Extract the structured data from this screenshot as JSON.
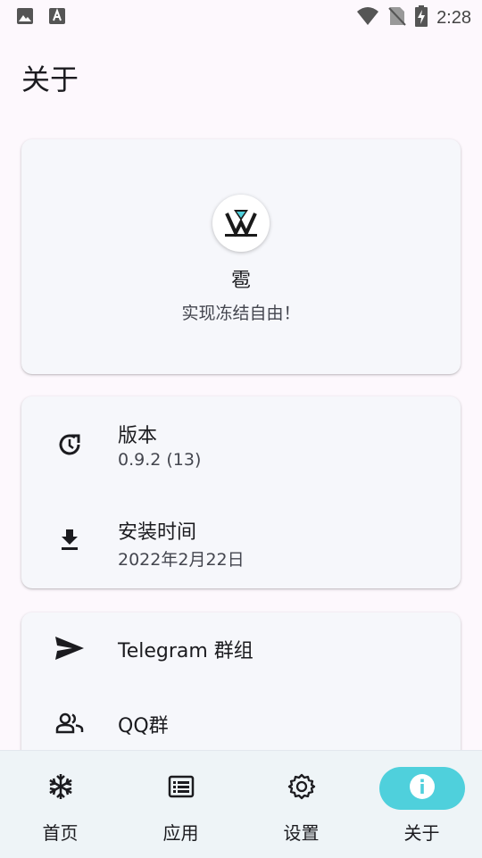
{
  "status_bar": {
    "time": "2:28"
  },
  "page": {
    "title": "关于"
  },
  "app": {
    "name": "雹",
    "tagline": "实现冻结自由！"
  },
  "info": {
    "version": {
      "label": "版本",
      "value": "0.9.2 (13)"
    },
    "install": {
      "label": "安装时间",
      "value": "2022年2月22日"
    }
  },
  "links": {
    "telegram": {
      "label": "Telegram 群组"
    },
    "qq": {
      "label": "QQ群"
    }
  },
  "nav": {
    "items": [
      {
        "label": "首页",
        "icon": "snowflake-icon",
        "active": false
      },
      {
        "label": "应用",
        "icon": "list-icon",
        "active": false
      },
      {
        "label": "设置",
        "icon": "gear-icon",
        "active": false
      },
      {
        "label": "关于",
        "icon": "info-icon",
        "active": true
      }
    ]
  },
  "colors": {
    "accent": "#4fd0dc",
    "background": "#fdf8fd",
    "card": "#f6f7fb",
    "nav": "#eef4f7"
  }
}
